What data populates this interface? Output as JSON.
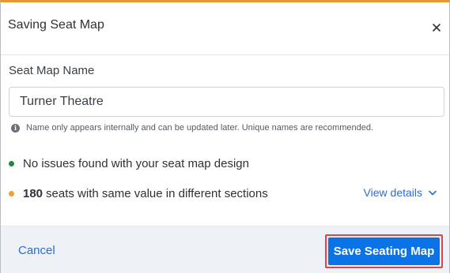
{
  "dialog": {
    "title": "Saving Seat Map",
    "close_icon": "close-icon",
    "accent_color": "#e8962f"
  },
  "form": {
    "label": "Seat Map Name",
    "value": "Turner Theatre",
    "helper_text": "Name only appears internally and can be updated later. Unique names are recommended.",
    "helper_icon": "info-icon"
  },
  "validation": {
    "ok_text": "No issues found with your seat map design",
    "ok_color": "#1f8a3b",
    "warning_count": "180",
    "warning_text": "seats with same value in different sections",
    "warning_color": "#f0a02b",
    "details_link": "View details",
    "details_icon": "chevron-down-icon"
  },
  "footer": {
    "cancel_label": "Cancel",
    "save_label": "Save Seating Map",
    "save_color": "#0b73e8",
    "highlight_color": "#e2434b"
  }
}
